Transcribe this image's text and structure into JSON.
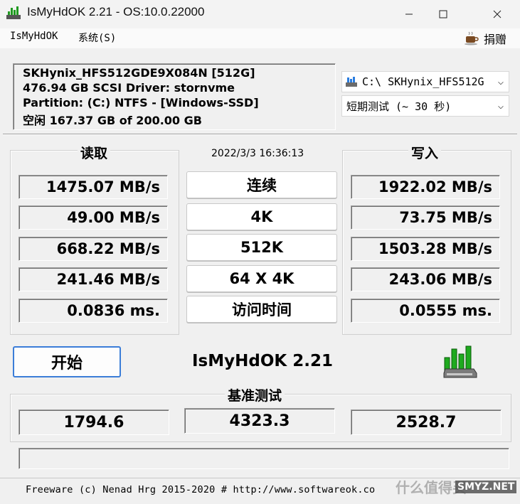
{
  "window": {
    "title": "IsMyHdOK 2.21 - OS:10.0.22000",
    "icons": {
      "app": "bar-graph-drive-icon",
      "minimize": "minimize-icon",
      "maximize": "maximize-icon",
      "close": "close-icon"
    }
  },
  "menu": {
    "items": [
      "IsMyHdOK",
      "系统(S)"
    ],
    "donate_label": "捐赠",
    "donate_icon": "coffee-cup-icon"
  },
  "drive_info": {
    "line1": "SKHynix_HFS512GDE9X084N [512G]",
    "line2": "476.94 GB  SCSI Driver: stornvme",
    "line3": "Partition: (C:) NTFS - [Windows-SSD]",
    "line4": "空闲 167.37 GB of 200.00 GB"
  },
  "selectors": {
    "drive": "C:\\ SKHynix_HFS512G",
    "drive_icon": "drive-icon",
    "duration": "短期测试 (~ 30 秒)"
  },
  "read": {
    "title": "读取",
    "values": [
      "1475.07 MB/s",
      "49.00 MB/s",
      "668.22 MB/s",
      "241.46 MB/s",
      "0.0836 ms."
    ]
  },
  "write": {
    "title": "写入",
    "values": [
      "1922.02 MB/s",
      "73.75 MB/s",
      "1503.28 MB/s",
      "243.06 MB/s",
      "0.0555 ms."
    ]
  },
  "timestamp": "2022/3/3 16:36:13",
  "tests": [
    "连续",
    "4K",
    "512K",
    "64 X 4K",
    "访问时间"
  ],
  "start_label": "开始",
  "center_title": "IsMyHdOK 2.21",
  "logo_icon": "green-bars-hdd-icon",
  "benchmark": {
    "title": "基准测试",
    "values": [
      "1794.6",
      "4323.3",
      "2528.7"
    ]
  },
  "status": "",
  "footer": "Freeware (c) Nenad Hrg 2015-2020 # http://www.softwareok.co",
  "watermark": "什么值得买",
  "watermark2": "SMYZ.NET",
  "colors": {
    "accent": "#3b7dd8",
    "logo_green": "#22b022"
  }
}
